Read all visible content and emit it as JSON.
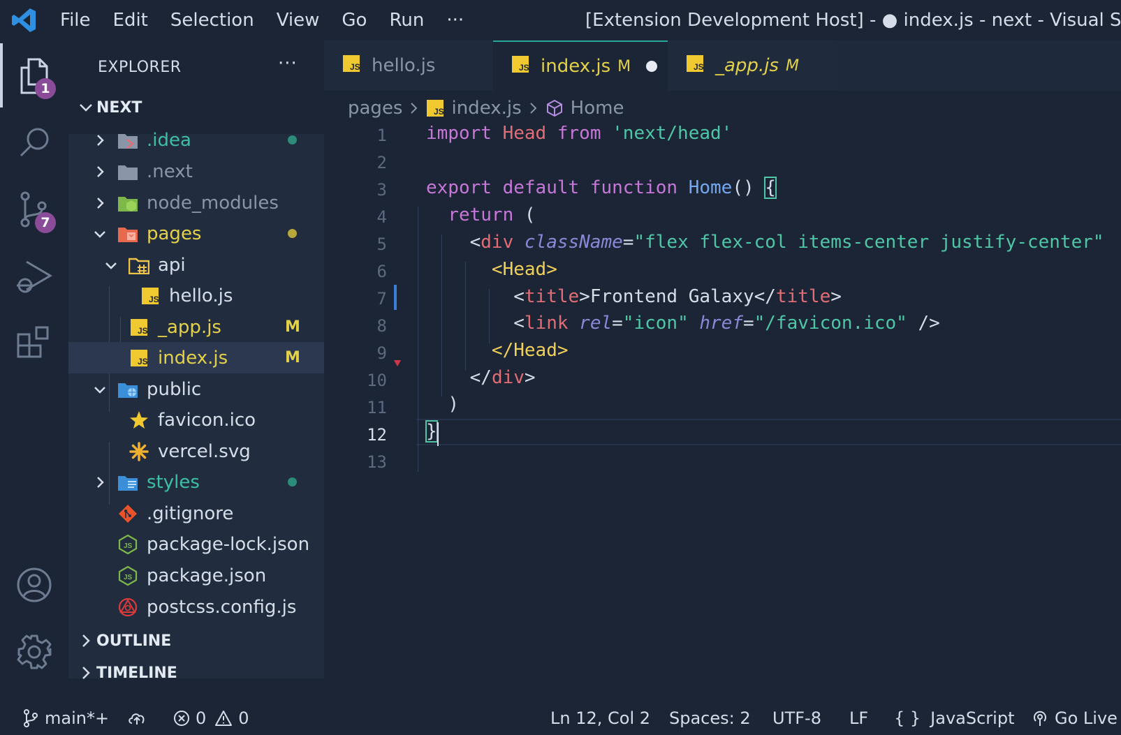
{
  "titlebar": {
    "menu": [
      "File",
      "Edit",
      "Selection",
      "View",
      "Go",
      "Run",
      "···"
    ],
    "window_title": "[Extension Development Host] - ● index.js - next - Visual Studio Code"
  },
  "activity": {
    "explorer_badge": "1",
    "scm_badge": "7"
  },
  "sidebar": {
    "title": "EXPLORER",
    "more": "···",
    "root": "NEXT",
    "items": [
      {
        "label": ".idea",
        "color": "#3dbfa3"
      },
      {
        "label": ".next",
        "color": "#8a96a8"
      },
      {
        "label": "node_modules",
        "color": "#8a96a8"
      },
      {
        "label": "pages",
        "color": "#e4d14a"
      },
      {
        "label": "api",
        "color": "#d6dde8"
      },
      {
        "label": "hello.js",
        "color": "#d6dde8"
      },
      {
        "label": "_app.js",
        "color": "#e4d14a",
        "status": "M"
      },
      {
        "label": "index.js",
        "color": "#e4d14a",
        "status": "M"
      },
      {
        "label": "public",
        "color": "#d6dde8"
      },
      {
        "label": "favicon.ico",
        "color": "#d6dde8"
      },
      {
        "label": "vercel.svg",
        "color": "#d6dde8"
      },
      {
        "label": "styles",
        "color": "#3dbfa3"
      },
      {
        "label": ".gitignore",
        "color": "#d6dde8"
      },
      {
        "label": "package-lock.json",
        "color": "#d6dde8"
      },
      {
        "label": "package.json",
        "color": "#d6dde8"
      },
      {
        "label": "postcss.config.js",
        "color": "#d6dde8"
      }
    ],
    "outline": "OUTLINE",
    "timeline": "TIMELINE"
  },
  "tabs": [
    {
      "label": "hello.js",
      "status": ""
    },
    {
      "label": "index.js",
      "status": "M"
    },
    {
      "label": "_app.js",
      "status": "M"
    }
  ],
  "breadcrumb": {
    "folder": "pages",
    "file": "index.js",
    "symbol": "Home"
  },
  "editor": {
    "line_numbers": [
      "1",
      "2",
      "3",
      "4",
      "5",
      "6",
      "7",
      "8",
      "9",
      "10",
      "11",
      "12",
      "13"
    ],
    "current_line": "12",
    "tokens": {
      "l1_import": "import",
      "l1_head": "Head",
      "l1_from": "from",
      "l1_str": "'next/head'",
      "l3_export": "export",
      "l3_default": "default",
      "l3_function": "function",
      "l3_home": "Home",
      "l3_parens": "()",
      "l3_brace": "{",
      "l4_return": "return",
      "l4_paren": "(",
      "l5_open": "<",
      "l5_div": "div",
      "l5_attr": "className",
      "l5_eq": "=",
      "l5_str": "\"flex flex-col items-center justify-center\"",
      "l6_tag": "<Head>",
      "l7_title_open": "title",
      "l7_text": "Frontend Galaxy",
      "l7_title_close": "title",
      "l8_link": "link",
      "l8_rel": "rel",
      "l8_rel_val": "\"icon\"",
      "l8_href": "href",
      "l8_href_val": "\"/favicon.ico\"",
      "l8_end": " />",
      "l9_tag": "</Head>",
      "l10_div": "div",
      "l11_paren": ")",
      "l12_brace": "}"
    }
  },
  "statusbar": {
    "branch": "main*+",
    "errors": "0",
    "warnings": "0",
    "position": "Ln 12, Col 2",
    "spaces": "Spaces: 2",
    "encoding": "UTF-8",
    "eol": "LF",
    "language": "JavaScript",
    "golive": "Go Live"
  }
}
